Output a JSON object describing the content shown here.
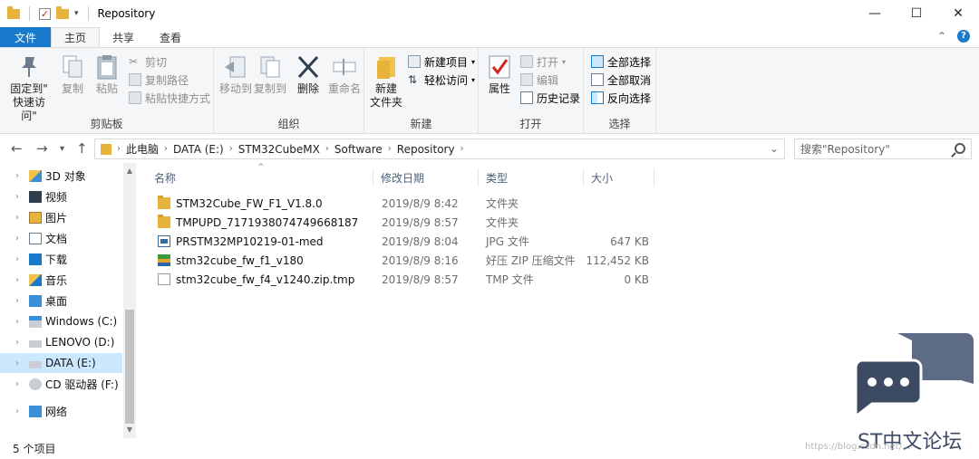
{
  "window": {
    "title": "Repository",
    "minimize": "—",
    "maximize": "☐",
    "close": "✕"
  },
  "tabs": [
    {
      "label": "文件"
    },
    {
      "label": "主页"
    },
    {
      "label": "共享"
    },
    {
      "label": "查看"
    }
  ],
  "ribbon": {
    "clipboard": {
      "label": "剪贴板",
      "pin": "固定到\"\n快速访问\"",
      "pin_line1": "固定到\"",
      "pin_line2": "快速访问\"",
      "copy": "复制",
      "paste": "粘贴",
      "cut": "剪切",
      "copy_path": "复制路径",
      "paste_shortcut": "粘贴快捷方式"
    },
    "organize": {
      "label": "组织",
      "move_to": "移动到",
      "copy_to": "复制到",
      "delete": "删除",
      "rename": "重命名"
    },
    "new": {
      "label": "新建",
      "new_folder_line1": "新建",
      "new_folder_line2": "文件夹",
      "new_item": "新建项目",
      "easy_access": "轻松访问"
    },
    "open": {
      "label": "打开",
      "properties": "属性",
      "open": "打开",
      "edit": "编辑",
      "history": "历史记录"
    },
    "select": {
      "label": "选择",
      "select_all": "全部选择",
      "select_none": "全部取消",
      "invert": "反向选择"
    }
  },
  "address": {
    "crumbs": [
      "此电脑",
      "DATA (E:)",
      "STM32CubeMX",
      "Software",
      "Repository"
    ]
  },
  "search": {
    "placeholder": "搜索\"Repository\""
  },
  "sidebar": {
    "items": [
      {
        "label": "3D 对象",
        "icon": "3d-objects-icon"
      },
      {
        "label": "视频",
        "icon": "videos-icon"
      },
      {
        "label": "图片",
        "icon": "pictures-icon"
      },
      {
        "label": "文档",
        "icon": "documents-icon"
      },
      {
        "label": "下载",
        "icon": "downloads-icon"
      },
      {
        "label": "音乐",
        "icon": "music-icon"
      },
      {
        "label": "桌面",
        "icon": "desktop-icon"
      },
      {
        "label": "Windows (C:)",
        "icon": "drive-icon"
      },
      {
        "label": "LENOVO (D:)",
        "icon": "drive-icon"
      },
      {
        "label": "DATA (E:)",
        "icon": "drive-icon"
      },
      {
        "label": "CD 驱动器 (F:)",
        "icon": "cd-drive-icon"
      },
      {
        "label": "网络",
        "icon": "network-icon"
      }
    ]
  },
  "columns": {
    "name": "名称",
    "modified": "修改日期",
    "type": "类型",
    "size": "大小"
  },
  "files": [
    {
      "name": "STM32Cube_FW_F1_V1.8.0",
      "modified": "2019/8/9 8:42",
      "type": "文件夹",
      "size": ""
    },
    {
      "name": "TMPUPD_7171938074749668187",
      "modified": "2019/8/9 8:57",
      "type": "文件夹",
      "size": ""
    },
    {
      "name": "PRSTM32MP10219-01-med",
      "modified": "2019/8/9 8:04",
      "type": "JPG 文件",
      "size": "647 KB"
    },
    {
      "name": "stm32cube_fw_f1_v180",
      "modified": "2019/8/9 8:16",
      "type": "好压 ZIP 压缩文件",
      "size": "112,452 KB"
    },
    {
      "name": "stm32cube_fw_f4_v1240.zip.tmp",
      "modified": "2019/8/9 8:57",
      "type": "TMP 文件",
      "size": "0 KB"
    }
  ],
  "status": {
    "count": "5 个项目"
  },
  "watermark": {
    "text": "ST中文论坛",
    "url": "https://blog.csdn.net/..."
  }
}
